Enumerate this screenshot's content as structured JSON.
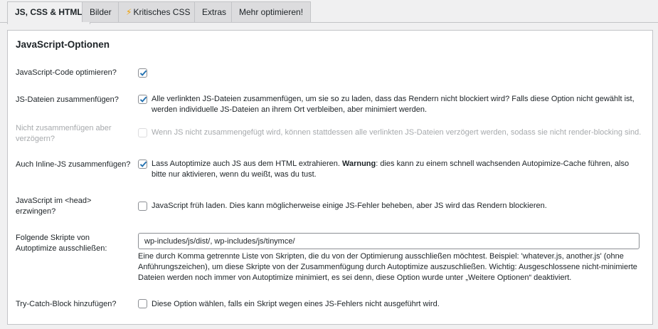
{
  "tabs": [
    {
      "label": "JS, CSS & HTML"
    },
    {
      "label": "Bilder"
    },
    {
      "label": "Kritisches CSS"
    },
    {
      "label": "Extras"
    },
    {
      "label": "Mehr optimieren!"
    }
  ],
  "section": {
    "title": "JavaScript-Optionen"
  },
  "options": {
    "optimize": {
      "label": "JavaScript-Code optimieren?"
    },
    "aggregate": {
      "label": "JS-Dateien zusammenfügen?",
      "desc": "Alle verlinkten JS-Dateien zusammenfügen, um sie so zu laden, dass das Rendern nicht blockiert wird? Falls diese Option nicht gewählt ist, werden individuelle JS-Dateien an ihrem Ort verbleiben, aber minimiert werden."
    },
    "defer": {
      "label": "Nicht zusammenfügen aber verzögern?",
      "desc": "Wenn JS nicht zusammengefügt wird, können stattdessen alle verlinkten JS-Dateien verzögert werden, sodass sie nicht render-blocking sind."
    },
    "inline": {
      "label": "Auch Inline-JS zusammenfügen?",
      "desc_before": "Lass Autoptimize auch JS aus dem HTML extrahieren. ",
      "desc_strong": "Warnung",
      "desc_after": ": dies kann zu einem schnell wachsenden Autopimize-Cache führen, also bitte nur aktivieren, wenn du weißt, was du tust."
    },
    "head": {
      "label": "JavaScript im <head> erzwingen?",
      "desc": "JavaScript früh laden. Dies kann möglicherweise einige JS-Fehler beheben, aber JS wird das Rendern blockieren."
    },
    "exclude": {
      "label": "Folgende Skripte von Autoptimize ausschließen:",
      "value": "wp-includes/js/dist/, wp-includes/js/tinymce/",
      "help": "Eine durch Komma getrennte Liste von Skripten, die du von der Optimierung ausschließen möchtest. Beispiel: 'whatever.js, another.js' (ohne Anführungszeichen), um diese Skripte von der Zusammenfügung durch Autoptimize auszuschließen. Wichtig: Ausgeschlossene nicht-minimierte Dateien werden noch immer von Autoptimize minimiert, es sei denn, diese Option wurde unter „Weitere Optionen“ deaktiviert."
    },
    "trycatch": {
      "label": "Try-Catch-Block hinzufügen?",
      "desc": "Diese Option wählen, falls ein Skript wegen eines JS-Fehlers nicht ausgeführt wird."
    }
  },
  "colors": {
    "checkmark": "#2271b1",
    "bolt": "#f0a000"
  }
}
